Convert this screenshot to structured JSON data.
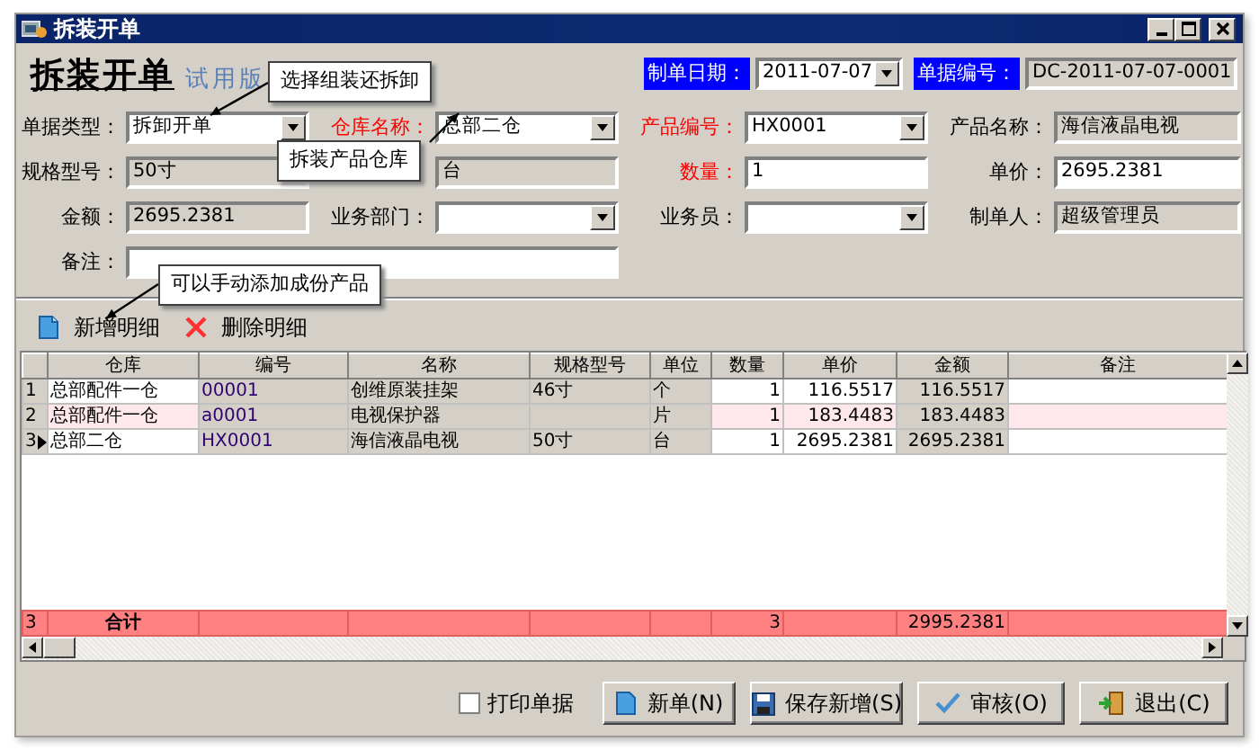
{
  "window": {
    "title": "拆装开单"
  },
  "heading": {
    "title": "拆装开单",
    "edition": "试用版"
  },
  "header_fields": [
    {
      "label": "制单日期：",
      "value": "2011-07-07",
      "kind": "dropdown",
      "highlighted": true
    },
    {
      "label": "单据编号：",
      "value": "DC-2011-07-07-0001",
      "kind": "readonly",
      "highlighted": true
    }
  ],
  "form_rows": [
    [
      {
        "label": "单据类型：",
        "value": "拆卸开单",
        "kind": "dropdown",
        "required": false,
        "highlighted": false
      },
      {
        "label": "仓库名称：",
        "value": "总部二仓",
        "kind": "dropdown",
        "required": true,
        "highlighted": false
      },
      {
        "label": "产品编号：",
        "value": "HX0001",
        "kind": "dropdown",
        "required": true,
        "highlighted": false
      },
      {
        "label": "产品名称：",
        "value": "海信液晶电视",
        "kind": "readonly",
        "required": false,
        "highlighted": false
      }
    ],
    [
      {
        "label": "规格型号：",
        "value": "50寸",
        "kind": "readonly",
        "required": false,
        "highlighted": false
      },
      {
        "value": "台",
        "kind": "readonly"
      },
      {
        "label": "数量：",
        "value": "1",
        "kind": "input",
        "required": true,
        "highlighted": false
      },
      {
        "label": "单价：",
        "value": "2695.2381",
        "kind": "input",
        "required": false,
        "highlighted": false
      }
    ],
    [
      {
        "label": "金额：",
        "value": "2695.2381",
        "kind": "readonly",
        "required": false,
        "highlighted": false
      },
      {
        "label": "业务部门：",
        "kind": "dropdown",
        "required": false,
        "highlighted": false
      },
      {
        "label": "业务员：",
        "kind": "dropdown",
        "required": false,
        "highlighted": false
      },
      {
        "label": "制单人：",
        "value": "超级管理员",
        "kind": "readonly",
        "required": false,
        "highlighted": false
      }
    ],
    [
      {
        "label": "备注：",
        "kind": "wide-input",
        "required": false,
        "highlighted": false
      }
    ]
  ],
  "callouts": [
    {
      "text": "选择组装还拆卸"
    },
    {
      "text": "拆装产品仓库"
    },
    {
      "text": "可以手动添加成份产品"
    }
  ],
  "toolbar": [
    {
      "label": "新增明细",
      "kind": "add"
    },
    {
      "label": "删除明细",
      "kind": "delete"
    }
  ],
  "table": {
    "columns": [
      {
        "label": "仓库",
        "kind": "text",
        "editable": true
      },
      {
        "label": "编号",
        "kind": "code",
        "editable": false
      },
      {
        "label": "名称",
        "kind": "text",
        "editable": false
      },
      {
        "label": "规格型号",
        "kind": "text",
        "editable": false
      },
      {
        "label": "单位",
        "kind": "text",
        "editable": false
      },
      {
        "label": "数量",
        "kind": "number",
        "editable": true
      },
      {
        "label": "单价",
        "kind": "number",
        "editable": true
      },
      {
        "label": "金额",
        "kind": "number",
        "editable": false
      },
      {
        "label": "备注",
        "kind": "text",
        "editable": true
      }
    ],
    "rows": [
      {
        "row_number": "1",
        "current": false,
        "highlighted": false,
        "cells": [
          "总部配件一仓",
          "00001",
          "创维原装挂架",
          "46寸",
          "个",
          "1",
          "116.5517",
          "116.5517",
          null
        ]
      },
      {
        "row_number": "2",
        "current": false,
        "highlighted": true,
        "cells": [
          "总部配件一仓",
          "a0001",
          "电视保护器",
          null,
          "片",
          "1",
          "183.4483",
          "183.4483",
          null
        ]
      },
      {
        "row_number": "3",
        "current": true,
        "highlighted": false,
        "cells": [
          "总部二仓",
          "HX0001",
          "海信液晶电视",
          "50寸",
          "台",
          "1",
          "2695.2381",
          "2695.2381",
          null
        ]
      }
    ],
    "total": {
      "row_number": "3",
      "label": "合计",
      "quantity": "3",
      "amount": "2995.2381"
    }
  },
  "print_option": {
    "label": "打印单据",
    "checked": false
  },
  "buttons": [
    {
      "label": "新单(N)",
      "kind": "new"
    },
    {
      "label": "保存新增(S)",
      "kind": "save"
    },
    {
      "label": "审核(O)",
      "kind": "approve"
    },
    {
      "label": "退出(C)",
      "kind": "exit"
    }
  ]
}
